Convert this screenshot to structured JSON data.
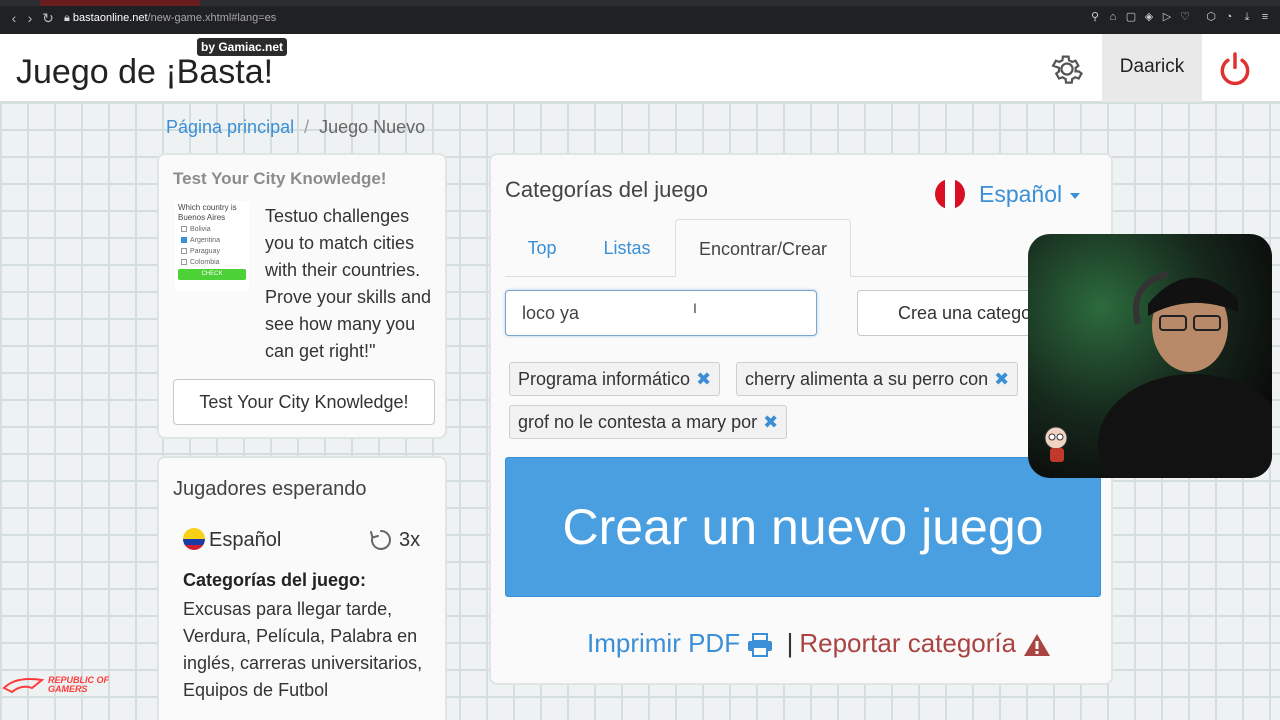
{
  "browser": {
    "url_host": "bastaonline.net",
    "url_path": "/new-game.xhtml#lang=es"
  },
  "header": {
    "title": "Juego de ¡Basta!",
    "badge": "by Gamiac.net",
    "user_name": "Daarick"
  },
  "breadcrumb": {
    "home": "Página principal",
    "separator": "/",
    "current": "Juego Nuevo"
  },
  "ad": {
    "title": "Test Your City Knowledge!",
    "image_question": "Which country is Buenos Aires",
    "image_options": [
      "Bolivia",
      "Argentina",
      "Paraguay",
      "Colombia"
    ],
    "image_button": "CHECK",
    "text": "Testuo challenges you to match cities with their countries. Prove your skills and see how many you can get right!\"",
    "button": "Test Your City Knowledge!"
  },
  "players": {
    "title": "Jugadores esperando",
    "language": "Español",
    "rounds": "3x",
    "categories_title": "Categorías del juego:",
    "categories": "Excusas para llegar tarde, Verdura, Película, Palabra en inglés, carreras universitarios, Equipos de Futbol"
  },
  "game": {
    "title": "Categorías del juego",
    "language": "Español",
    "tabs": [
      {
        "label": "Top"
      },
      {
        "label": "Listas"
      },
      {
        "label": "Encontrar/Crear"
      }
    ],
    "search_value": "loco ya",
    "create_category_button": "Crea una catego",
    "chips": [
      "Programa informático",
      "cherry alimenta a su perro con",
      "grof no le contesta a mary por"
    ],
    "create_game_button": "Crear un nuevo juego",
    "print_pdf": "Imprimir PDF",
    "pipe": "|",
    "report_category": "Reportar categoría"
  },
  "watermark": {
    "line1": "REPUBLIC OF",
    "line2": "GAMERS"
  },
  "colors": {
    "link_blue": "#3a8fd6",
    "create_button_blue": "#4a9fe0",
    "report_red": "#a94442",
    "power_red": "#e03030"
  }
}
